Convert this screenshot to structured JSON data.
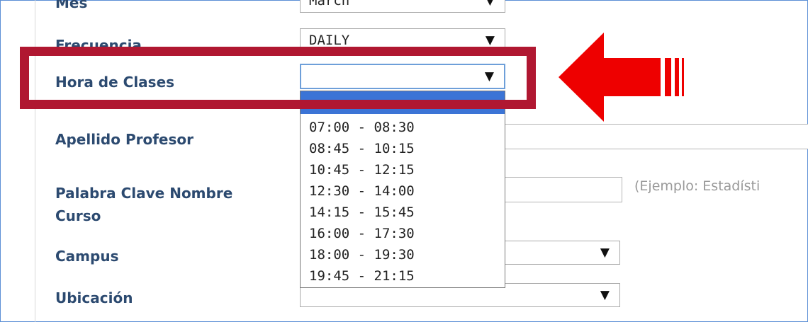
{
  "form": {
    "mes": {
      "label": "Mes",
      "value": "March"
    },
    "frecuencia": {
      "label": "Frecuencia",
      "value": "DAILY"
    },
    "hora": {
      "label": "Hora de Clases",
      "value": "",
      "options": [
        "07:00 - 08:30",
        "08:45 - 10:15",
        "10:45 - 12:15",
        "12:30 - 14:00",
        "14:15 - 15:45",
        "16:00 - 17:30",
        "18:00 - 19:30",
        "19:45 - 21:15"
      ]
    },
    "apellido": {
      "label": "Apellido Profesor",
      "value": ""
    },
    "palabra": {
      "label_line1": "Palabra Clave Nombre",
      "label_line2": "Curso",
      "value": "",
      "hint": "(Ejemplo: Estadísti"
    },
    "campus": {
      "label": "Campus",
      "value": ""
    },
    "ubicacion": {
      "label": "Ubicación",
      "value": ""
    }
  },
  "icons": {
    "dropdown_arrow": "▼",
    "callout": "left-arrow-icon"
  },
  "colors": {
    "label": "#2c4a70",
    "highlight": "#b01731",
    "arrow": "#ee0000",
    "selected_option": "#3b74d6"
  }
}
